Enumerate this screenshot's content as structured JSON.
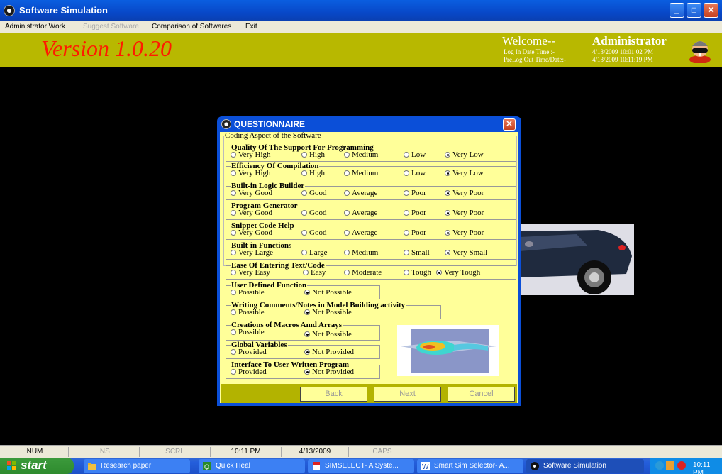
{
  "window": {
    "title": "Software Simulation"
  },
  "menu": [
    "Administrator Work",
    "Suggest Software",
    "Comparison of Softwares",
    "Exit"
  ],
  "header": {
    "version": "Version 1.0.20",
    "welcome": "Welcome--",
    "user": "Administrator",
    "login_label": "Log In Date Time :-",
    "login_value": "4/13/2009 10:01:02 PM",
    "prelogout_label": "PreLog Out Time/Date:-",
    "prelogout_value": "4/13/2009 10:11:19 PM"
  },
  "dialog": {
    "title": "QUESTIONNAIRE",
    "section": "Coding Aspect of the Software",
    "groups": [
      {
        "label": "Quality Of The Support For Programming",
        "options": [
          "Very High",
          "High",
          "Medium",
          "Low",
          "Very Low"
        ],
        "selected": 4
      },
      {
        "label": "Efficiency Of Compilation",
        "options": [
          "Very High",
          "High",
          "Medium",
          "Low",
          "Very Low"
        ],
        "selected": 4
      },
      {
        "label": "Built-in Logic Builder",
        "options": [
          "Very Good",
          "Good",
          "Average",
          "Poor",
          "Very Poor"
        ],
        "selected": 4
      },
      {
        "label": "Program Generator",
        "options": [
          "Very Good",
          "Good",
          "Average",
          "Poor",
          "Very Poor"
        ],
        "selected": 4
      },
      {
        "label": "Snippet Code Help",
        "options": [
          "Very Good",
          "Good",
          "Average",
          "Poor",
          "Very Poor"
        ],
        "selected": 4
      },
      {
        "label": "Built-in Functions",
        "options": [
          "Very Large",
          "Large",
          "Medium",
          "Small",
          "Very Small"
        ],
        "selected": 4
      },
      {
        "label": "Ease Of Entering Text/Code",
        "options": [
          "Very Easy",
          "Easy",
          "Moderate",
          "Tough",
          "Very Tough"
        ],
        "selected": 4
      },
      {
        "label": "User Defined Function",
        "options": [
          "Possible",
          "Not Possible"
        ],
        "selected": 1
      },
      {
        "label": "Writing Comments/Notes in Model Building activity",
        "options": [
          "Possible",
          "Not Possible"
        ],
        "selected": 1
      },
      {
        "label": "Creations of Macros Amd Arrays",
        "options": [
          "Possible",
          "Not Possible"
        ],
        "selected": 1
      },
      {
        "label": "Global Variables",
        "options": [
          "Provided",
          "Not Provided"
        ],
        "selected": 1
      },
      {
        "label": "Interface To User Written Program",
        "options": [
          "Provided",
          "Not Provided"
        ],
        "selected": 1
      }
    ],
    "buttons": {
      "back": "Back",
      "next": "Next",
      "cancel": "Cancel"
    }
  },
  "statusbar": [
    "NUM",
    "INS",
    "SCRL",
    "10:11 PM",
    "4/13/2009",
    "CAPS"
  ],
  "taskbar": {
    "start": "start",
    "tasks": [
      "Research paper",
      "Quick Heal",
      "SIMSELECT- A Syste...",
      "Smart Sim Selector- A...",
      "Software Simulation"
    ],
    "clock": "10:11 PM"
  },
  "colors": {
    "header_bg": "#b8b800",
    "version_text": "#ff1a00",
    "dialog_bg": "#ffff99",
    "dialog_footer": "#b3b300"
  }
}
